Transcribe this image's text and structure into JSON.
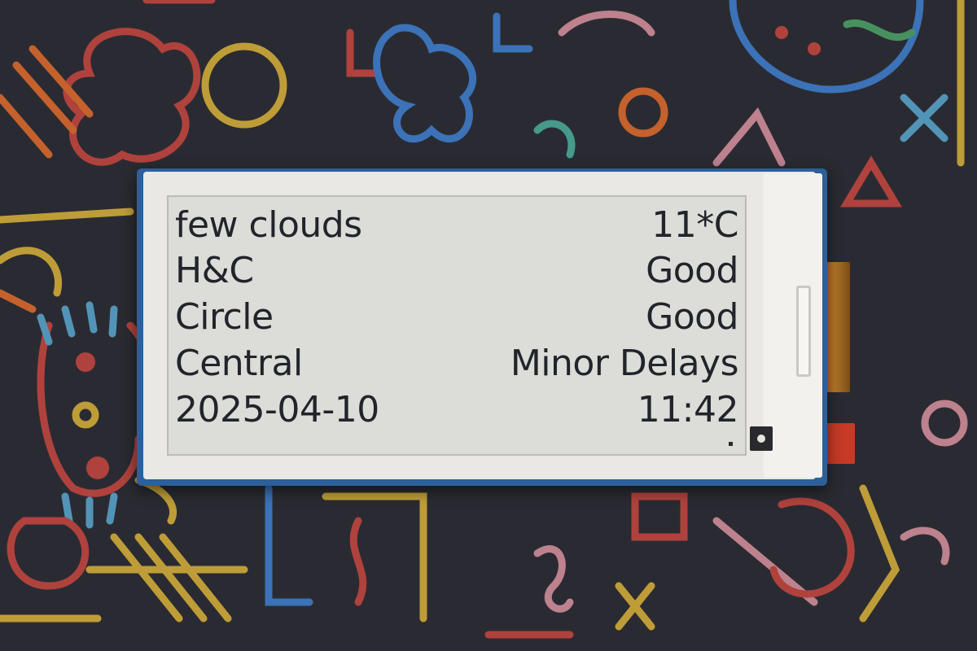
{
  "display": {
    "rows": [
      {
        "left": "few clouds",
        "right": "11*C"
      },
      {
        "left": "H&C",
        "right": "Good"
      },
      {
        "left": "Circle",
        "right": "Good"
      },
      {
        "left": "Central",
        "right": "Minor Delays"
      },
      {
        "left": "2025-04-10",
        "right": "11:42"
      }
    ]
  },
  "colors": {
    "background": "#2a2b32",
    "bezel": "#e9e8e4",
    "pcb": "#2d5f9a",
    "screen": "#dcdcd8",
    "ink": "#22242b",
    "tab": "#c83a26"
  }
}
